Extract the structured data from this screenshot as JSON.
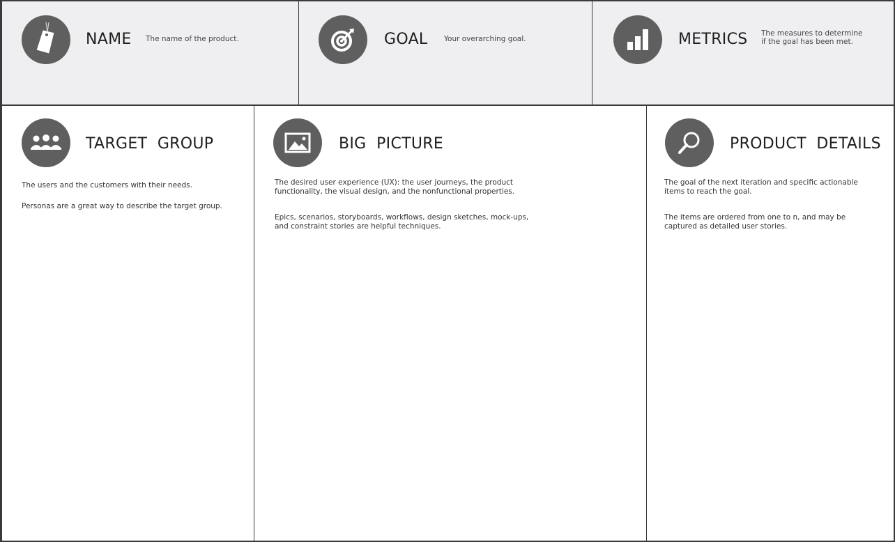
{
  "top": {
    "name": {
      "icon": "tag-icon",
      "title": "NAME",
      "subtitle": "The name of the product."
    },
    "goal": {
      "icon": "target-icon",
      "title": "GOAL",
      "subtitle": "Your overarching goal."
    },
    "metrics": {
      "icon": "bar-chart-icon",
      "title": "METRICS",
      "subtitle_line1": "The measures to determine",
      "subtitle_line2": "if the goal has been met."
    }
  },
  "bottom": {
    "target_group": {
      "icon": "users-icon",
      "title": "TARGET  GROUP",
      "p1": "The users and the customers with their needs.",
      "p2": "Personas are a great way to describe the target group."
    },
    "big_picture": {
      "icon": "image-icon",
      "title": "BIG  PICTURE",
      "p1_line1": "The desired user experience (UX): the user journeys, the product",
      "p1_line2": "functionality, the visual design, and the nonfunctional properties.",
      "p2_line1": "Epics, scenarios, storyboards, workflows, design sketches, mock-ups,",
      "p2_line2": "and constraint stories are helpful techniques."
    },
    "product_details": {
      "icon": "magnifier-icon",
      "title": "PRODUCT  DETAILS",
      "p1_line1": "The goal of the next iteration and specific actionable",
      "p1_line2": "items to reach the goal.",
      "p2_line1": "The items are ordered from one to n, and may be",
      "p2_line2": "captured as detailed user stories."
    }
  },
  "colors": {
    "icon_bg": "#5f5f5f",
    "top_bg": "#efeff1",
    "border": "#3a3a3a"
  }
}
